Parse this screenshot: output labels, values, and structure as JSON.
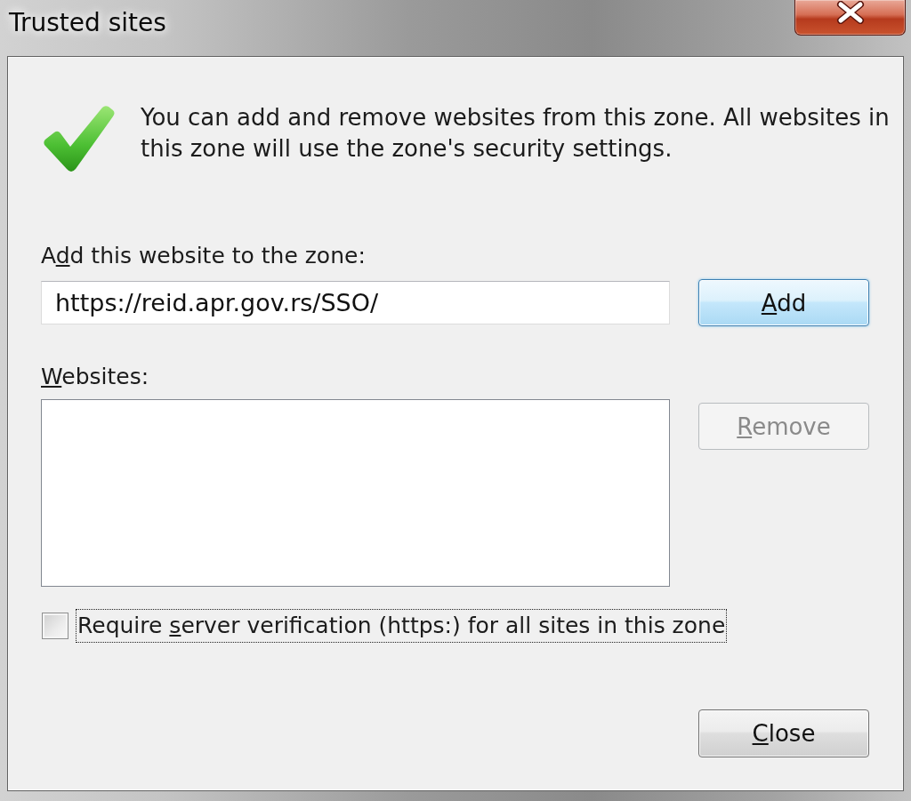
{
  "window": {
    "title": "Trusted sites"
  },
  "message": {
    "text": "You can add and remove websites from this zone. All websites in this zone will use the zone's security settings."
  },
  "add_site": {
    "label": [
      {
        "text": "A",
        "underline": false
      },
      {
        "text": "d",
        "underline": true
      },
      {
        "text": "d this website to the zone:",
        "underline": false
      }
    ],
    "value": "https://reid.apr.gov.rs/SSO/",
    "button": {
      "label": [
        {
          "text": "A",
          "underline": true
        },
        {
          "text": "dd",
          "underline": false
        }
      ],
      "default": true,
      "disabled": false
    }
  },
  "websites": {
    "label": [
      {
        "text": "W",
        "underline": true
      },
      {
        "text": "ebsites:",
        "underline": false
      }
    ],
    "button": {
      "label": [
        {
          "text": "R",
          "underline": true
        },
        {
          "text": "emove",
          "underline": false
        }
      ],
      "disabled": true
    }
  },
  "require_https": {
    "label": [
      {
        "text": "Require ",
        "underline": false
      },
      {
        "text": "s",
        "underline": true
      },
      {
        "text": "erver verification (https:) for all sites in this zone",
        "underline": false
      }
    ],
    "checked": false,
    "focused": true
  },
  "close_button": {
    "label": [
      {
        "text": "C",
        "underline": true
      },
      {
        "text": "lose",
        "underline": false
      }
    ],
    "default": false,
    "disabled": false
  }
}
